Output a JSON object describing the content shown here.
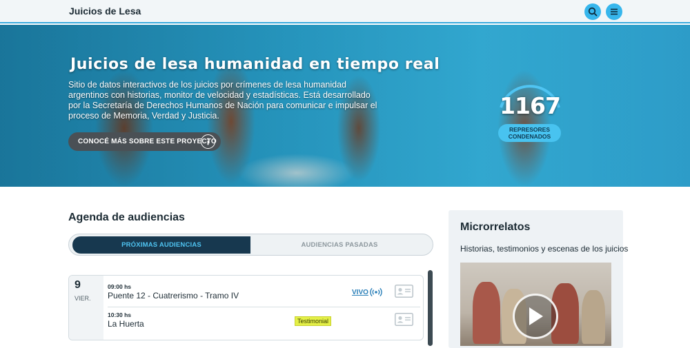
{
  "header": {
    "brand": "Juicios de Lesa",
    "icons": [
      "search-icon",
      "menu-icon"
    ],
    "accent": "#37b6ec"
  },
  "hero": {
    "title": "Juicios de lesa humanidad en tiempo real",
    "description": "Sitio de datos interactivos de los juicios por crímenes de lesa humanidad argentinos con historias, monitor de velocidad y estadísticas. Está desarrollado por la Secretaría de Derechos Humanos de Nación para comunicar e impulsar el proceso de Memoria, Verdad y Justicia.",
    "cta_label": "CONOCÉ MÁS SOBRE ESTE PROYECTO",
    "counter": {
      "value": "1167",
      "label_line1": "REPRESORES",
      "label_line2": "CONDENADOS"
    }
  },
  "agenda": {
    "title": "Agenda de audiencias",
    "tabs": [
      {
        "label": "PRÓXIMAS AUDIENCIAS",
        "active": true
      },
      {
        "label": "AUDIENCIAS PASADAS",
        "active": false
      }
    ],
    "day": {
      "number": "9",
      "weekday": "VIER.",
      "hearings": [
        {
          "time": "09:00 hs",
          "name": "Puente 12 - Cuatrerismo - Tramo IV",
          "live_label": "VIVO"
        },
        {
          "time": "10:30 hs",
          "name": "La Huerta",
          "tag": "Testimonial"
        }
      ]
    }
  },
  "micro": {
    "title": "Microrrelatos",
    "subtitle": "Historias, testimonios y escenas de los juicios"
  }
}
